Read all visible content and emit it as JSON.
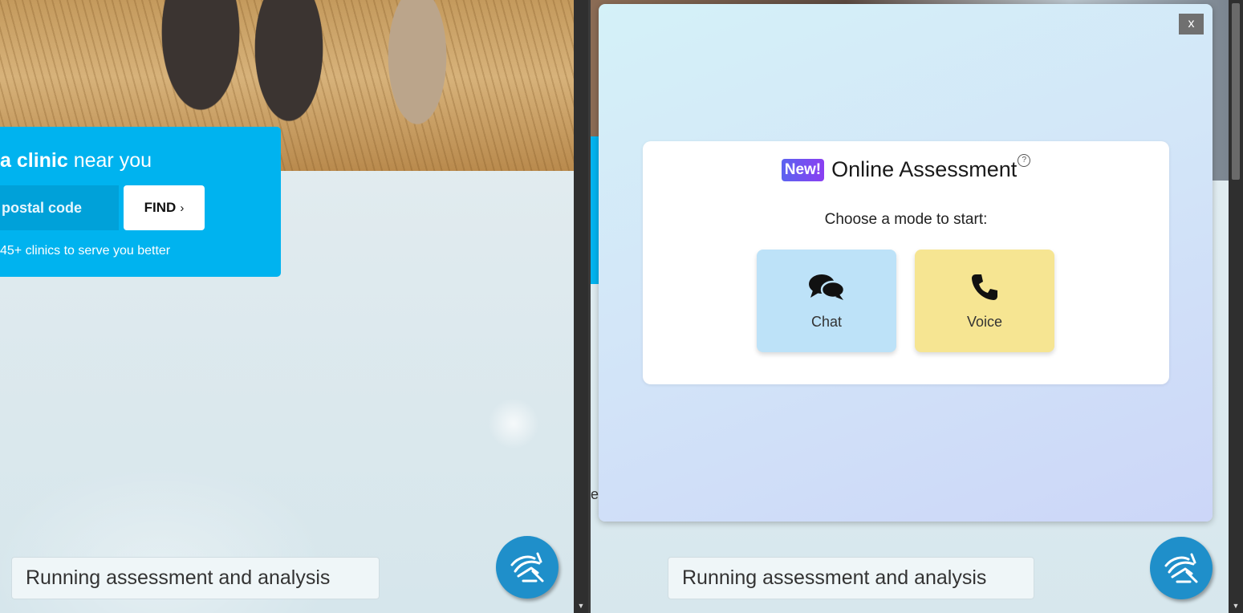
{
  "left": {
    "clinic_finder": {
      "heading_bold": "a clinic",
      "heading_rest": " near you",
      "postal_placeholder": "postal code",
      "find_label": "FIND",
      "note": "45+ clinics to serve you better"
    },
    "service_label": "Running assessment and analysis",
    "chat_fab_icon": "assistant-logo-icon"
  },
  "right": {
    "close_label": "x",
    "assessment": {
      "badge": "New!",
      "title": "Online Assessment",
      "help_icon": "question-circle-icon",
      "help_glyph": "?",
      "prompt": "Choose a mode to start:",
      "modes": [
        {
          "label": "Chat",
          "icon": "chat-bubbles-icon",
          "color": "#bde2f8"
        },
        {
          "label": "Voice",
          "icon": "phone-icon",
          "color": "#f6e592"
        }
      ]
    },
    "peek_letter": "e",
    "service_label": "Running assessment and analysis",
    "chat_fab_icon": "assistant-logo-icon"
  },
  "colors": {
    "accent": "#00b3ef",
    "fab": "#1f8fca",
    "badge_from": "#5b63f0",
    "badge_to": "#8a3ff1"
  }
}
